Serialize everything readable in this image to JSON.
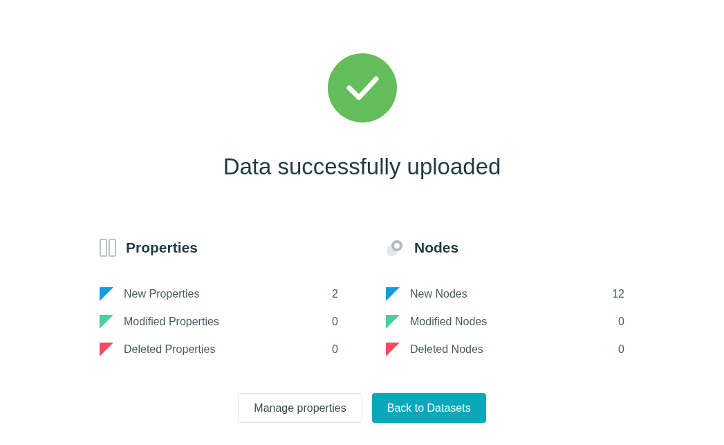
{
  "title": "Data successfully uploaded",
  "sections": [
    {
      "kind": "properties",
      "heading": "Properties",
      "rows": [
        {
          "label": "New Properties",
          "count": "2",
          "color": "#0d9de0"
        },
        {
          "label": "Modified Properties",
          "count": "0",
          "color": "#45d39b"
        },
        {
          "label": "Deleted Properties",
          "count": "0",
          "color": "#f44b63"
        }
      ]
    },
    {
      "kind": "nodes",
      "heading": "Nodes",
      "rows": [
        {
          "label": "New Nodes",
          "count": "12",
          "color": "#0d9de0"
        },
        {
          "label": "Modified Nodes",
          "count": "0",
          "color": "#45d39b"
        },
        {
          "label": "Deleted Nodes",
          "count": "0",
          "color": "#f44b63"
        }
      ]
    }
  ],
  "buttons": [
    {
      "label": "Manage properties",
      "kind": "secondary"
    },
    {
      "label": "Back to Datasets",
      "kind": "primary"
    }
  ]
}
